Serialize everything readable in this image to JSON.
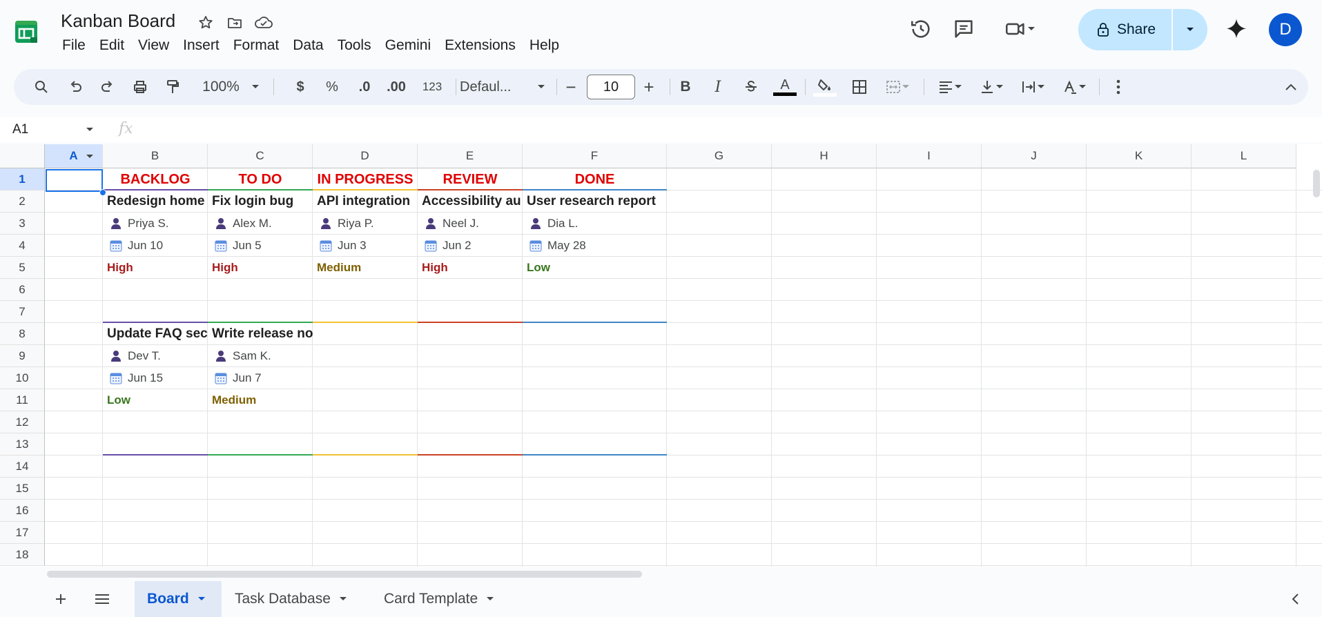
{
  "app": {
    "title": "Kanban Board",
    "menu": [
      "File",
      "Edit",
      "View",
      "Insert",
      "Format",
      "Data",
      "Tools",
      "Gemini",
      "Extensions",
      "Help"
    ],
    "share_label": "Share",
    "avatar_initial": "D"
  },
  "toolbar": {
    "zoom": "100%",
    "currency": "$",
    "percent": "%",
    "dec_decrease": ".0",
    "dec_increase": ".00",
    "number_format": "123",
    "font_name": "Defaul...",
    "font_size": "10",
    "minus": "−",
    "plus": "+",
    "bold": "B",
    "italic": "I",
    "text_color_letter": "A"
  },
  "formula_bar": {
    "cell_ref": "A1",
    "fx": "fx",
    "value": ""
  },
  "grid": {
    "columns": [
      "A",
      "B",
      "C",
      "D",
      "E",
      "F",
      "G",
      "H",
      "I",
      "J",
      "K",
      "L"
    ],
    "rows": [
      "1",
      "2",
      "3",
      "4",
      "5",
      "6",
      "7",
      "8",
      "9",
      "10",
      "11",
      "12",
      "13",
      "14",
      "15",
      "16",
      "17",
      "18"
    ],
    "selected_cell": "A1"
  },
  "board": {
    "headers": [
      "BACKLOG",
      "TO DO",
      "IN PROGRESS",
      "REVIEW",
      "DONE"
    ],
    "column_colors": [
      "#674ea7",
      "#34a853",
      "#f1c232",
      "#cc4125",
      "#3d85c6"
    ],
    "priority_colors": {
      "High": "#a61c1c",
      "Medium": "#7f5f00",
      "Low": "#38761d"
    },
    "cards_row1": [
      {
        "title": "Redesign home",
        "assignee": "Priya S.",
        "date": "Jun 10",
        "priority": "High"
      },
      {
        "title": "Fix login bug",
        "assignee": "Alex M.",
        "date": "Jun 5",
        "priority": "High"
      },
      {
        "title": "API integration",
        "assignee": "Riya P.",
        "date": "Jun 3",
        "priority": "Medium"
      },
      {
        "title": "Accessibility au",
        "assignee": "Neel J.",
        "date": "Jun 2",
        "priority": "High"
      },
      {
        "title": "User research report",
        "assignee": "Dia L.",
        "date": "May 28",
        "priority": "Low"
      }
    ],
    "cards_row2": [
      {
        "title": "Update FAQ sec",
        "assignee": "Dev T.",
        "date": "Jun 15",
        "priority": "Low"
      },
      {
        "title": "Write release notes",
        "assignee": "Sam K.",
        "date": "Jun 7",
        "priority": "Medium"
      }
    ]
  },
  "sheets": {
    "tabs": [
      "Board",
      "Task Database",
      "Card Template"
    ],
    "active": "Board"
  },
  "icons": [
    "sheets-logo-icon",
    "star-icon",
    "move-folder-icon",
    "cloud-status-icon",
    "version-history-icon",
    "comment-icon",
    "meet-icon",
    "lock-icon",
    "gemini-icon",
    "search-icon",
    "undo-icon",
    "redo-icon",
    "print-icon",
    "paint-format-icon",
    "strikethrough-icon",
    "fill-color-icon",
    "borders-icon",
    "merge-icon",
    "align-icon",
    "valign-icon",
    "wrap-icon",
    "rotate-icon",
    "more-icon",
    "collapse-icon",
    "person-icon",
    "calendar-icon",
    "add-sheet-icon",
    "all-sheets-icon"
  ]
}
